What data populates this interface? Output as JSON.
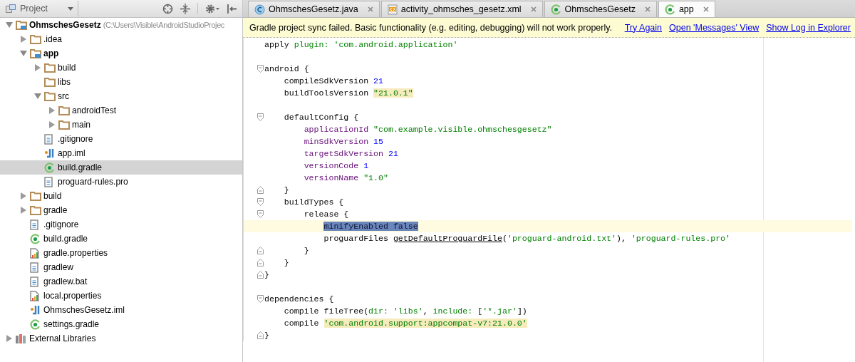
{
  "project_panel": {
    "view_selector": "Project",
    "tree": [
      {
        "label": "OhmschesGesetz",
        "suffix": "(C:\\Users\\Visible\\AndroidStudioProjec",
        "kind": "module",
        "expanded": true,
        "selected": false,
        "children": [
          {
            "label": ".idea",
            "kind": "folder",
            "expanded": false,
            "selected": false
          },
          {
            "label": "app",
            "kind": "module",
            "expanded": true,
            "selected": false,
            "children": [
              {
                "label": "build",
                "kind": "folder",
                "expanded": false,
                "selected": false
              },
              {
                "label": "libs",
                "kind": "folder",
                "selected": false
              },
              {
                "label": "src",
                "kind": "folder",
                "expanded": true,
                "selected": false,
                "children": [
                  {
                    "label": "androidTest",
                    "kind": "folder",
                    "expanded": false,
                    "selected": false
                  },
                  {
                    "label": "main",
                    "kind": "folder",
                    "expanded": false,
                    "selected": false
                  }
                ]
              },
              {
                "label": ".gitignore",
                "kind": "text",
                "selected": false
              },
              {
                "label": "app.iml",
                "kind": "iml",
                "selected": false
              },
              {
                "label": "build.gradle",
                "kind": "gradle",
                "selected": true
              },
              {
                "label": "proguard-rules.pro",
                "kind": "text",
                "selected": false
              }
            ]
          },
          {
            "label": "build",
            "kind": "folder",
            "expanded": false,
            "selected": false
          },
          {
            "label": "gradle",
            "kind": "folder",
            "expanded": false,
            "selected": false
          },
          {
            "label": ".gitignore",
            "kind": "text",
            "selected": false
          },
          {
            "label": "build.gradle",
            "kind": "gradle",
            "selected": false
          },
          {
            "label": "gradle.properties",
            "kind": "properties",
            "selected": false
          },
          {
            "label": "gradlew",
            "kind": "text",
            "selected": false
          },
          {
            "label": "gradlew.bat",
            "kind": "text",
            "selected": false
          },
          {
            "label": "local.properties",
            "kind": "properties",
            "selected": false
          },
          {
            "label": "OhmschesGesetz.iml",
            "kind": "iml",
            "selected": false
          },
          {
            "label": "settings.gradle",
            "kind": "gradle",
            "selected": false
          }
        ]
      },
      {
        "label": "External Libraries",
        "kind": "libraries",
        "expanded": false,
        "selected": false
      }
    ]
  },
  "editor": {
    "tabs": [
      {
        "label": "OhmschesGesetz.java",
        "kind": "class",
        "selected": false
      },
      {
        "label": "activity_ohmsches_gesetz.xml",
        "kind": "xml",
        "selected": false
      },
      {
        "label": "OhmschesGesetz",
        "kind": "gradle",
        "selected": false
      },
      {
        "label": "app",
        "kind": "gradle",
        "selected": true
      }
    ],
    "banner": {
      "message": "Gradle project sync failed. Basic functionality (e.g. editing, debugging) will not work properly.",
      "links": [
        "Try Again",
        "Open 'Messages' View",
        "Show Log in Explorer"
      ]
    },
    "lines": [
      {
        "kind": "code",
        "current": false,
        "tokens": [
          {
            "kind": "plain",
            "text": "apply "
          },
          {
            "kind": "named",
            "text": "plugin: "
          },
          {
            "kind": "string",
            "text": "'com.android.application'"
          }
        ]
      },
      {
        "kind": "code",
        "current": false
      },
      {
        "kind": "fold-start",
        "current": false,
        "tokens": [
          {
            "kind": "plain",
            "text": "android {"
          }
        ]
      },
      {
        "kind": "code",
        "current": false,
        "tokens": [
          {
            "kind": "plain",
            "text": "    compileSdkVersion "
          },
          {
            "kind": "number",
            "text": "21"
          }
        ]
      },
      {
        "kind": "code",
        "current": false,
        "tokens": [
          {
            "kind": "plain",
            "text": "    buildToolsVersion "
          },
          {
            "kind": "string-match",
            "text": "\"21.0.1\""
          }
        ]
      },
      {
        "kind": "code",
        "current": false
      },
      {
        "kind": "fold-start",
        "current": false,
        "tokens": [
          {
            "kind": "plain",
            "text": "    defaultConfig {"
          }
        ]
      },
      {
        "kind": "code",
        "current": false,
        "tokens": [
          {
            "kind": "property",
            "text": "        applicationId "
          },
          {
            "kind": "string",
            "text": "\"com.example.visible.ohmschesgesetz\""
          }
        ]
      },
      {
        "kind": "code",
        "current": false,
        "tokens": [
          {
            "kind": "property",
            "text": "        minSdkVersion "
          },
          {
            "kind": "number",
            "text": "15"
          }
        ]
      },
      {
        "kind": "code",
        "current": false,
        "tokens": [
          {
            "kind": "property",
            "text": "        targetSdkVersion "
          },
          {
            "kind": "number",
            "text": "21"
          }
        ]
      },
      {
        "kind": "code",
        "current": false,
        "tokens": [
          {
            "kind": "property",
            "text": "        versionCode "
          },
          {
            "kind": "number",
            "text": "1"
          }
        ]
      },
      {
        "kind": "code",
        "current": false,
        "tokens": [
          {
            "kind": "property",
            "text": "        versionName "
          },
          {
            "kind": "string",
            "text": "\"1.0\""
          }
        ]
      },
      {
        "kind": "fold-end",
        "current": false,
        "tokens": [
          {
            "kind": "plain",
            "text": "    }"
          }
        ]
      },
      {
        "kind": "fold-start",
        "current": false,
        "tokens": [
          {
            "kind": "plain",
            "text": "    buildTypes {"
          }
        ]
      },
      {
        "kind": "fold-start",
        "current": false,
        "tokens": [
          {
            "kind": "plain",
            "text": "        release {"
          }
        ]
      },
      {
        "kind": "code",
        "current": true,
        "tokens": [
          {
            "kind": "selection",
            "text": "minifyEnabled false"
          }
        ]
      },
      {
        "kind": "code",
        "current": false,
        "tokens": [
          {
            "kind": "plain",
            "text": "            proguardFiles "
          },
          {
            "kind": "call",
            "text": "getDefaultProguardFile"
          },
          {
            "kind": "plain",
            "text": "("
          },
          {
            "kind": "string",
            "text": "'proguard-android.txt'"
          },
          {
            "kind": "plain",
            "text": "), "
          },
          {
            "kind": "string",
            "text": "'proguard-rules.pro'"
          }
        ]
      },
      {
        "kind": "fold-end",
        "current": false,
        "tokens": [
          {
            "kind": "plain",
            "text": "        }"
          }
        ]
      },
      {
        "kind": "fold-end",
        "current": false,
        "tokens": [
          {
            "kind": "plain",
            "text": "    }"
          }
        ]
      },
      {
        "kind": "fold-end",
        "current": false,
        "tokens": [
          {
            "kind": "plain",
            "text": "}"
          }
        ]
      },
      {
        "kind": "code",
        "current": false
      },
      {
        "kind": "fold-start",
        "current": false,
        "tokens": [
          {
            "kind": "plain",
            "text": "dependencies {"
          }
        ]
      },
      {
        "kind": "code",
        "current": false,
        "tokens": [
          {
            "kind": "plain",
            "text": "    compile fileTree("
          },
          {
            "kind": "named",
            "text": "dir: "
          },
          {
            "kind": "string",
            "text": "'libs'"
          },
          {
            "kind": "plain",
            "text": ", "
          },
          {
            "kind": "named",
            "text": "include: "
          },
          {
            "kind": "plain",
            "text": "["
          },
          {
            "kind": "string",
            "text": "'*.jar'"
          },
          {
            "kind": "plain",
            "text": "])"
          }
        ]
      },
      {
        "kind": "code",
        "current": false,
        "tokens": [
          {
            "kind": "plain",
            "text": "    compile "
          },
          {
            "kind": "string-match",
            "text": "'com.android.support:appcompat-v7:21.0.0'"
          }
        ]
      },
      {
        "kind": "fold-end",
        "current": false,
        "tokens": [
          {
            "kind": "plain",
            "text": "}"
          }
        ]
      }
    ]
  }
}
